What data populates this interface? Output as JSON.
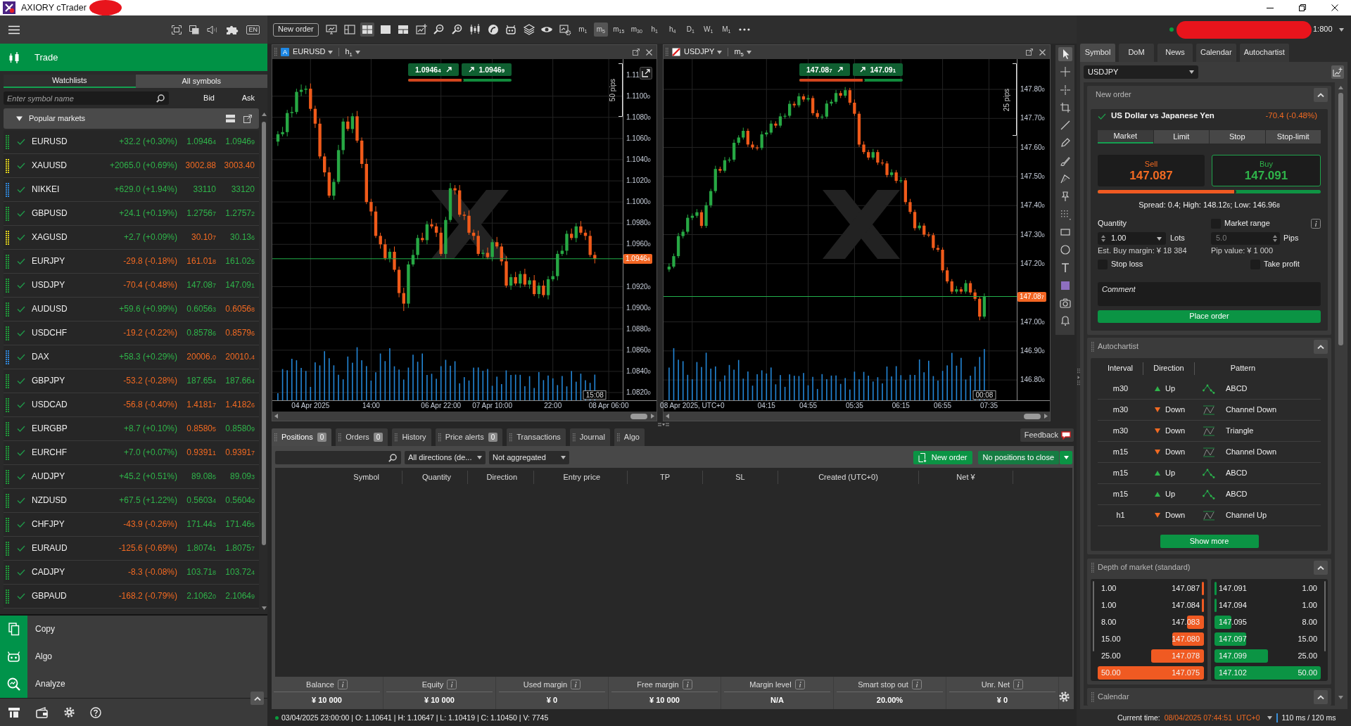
{
  "window": {
    "title": "AXIORY cTrader"
  },
  "left_panel": {
    "language": "EN",
    "section": "Trade",
    "tabs": [
      {
        "label": "Watchlists",
        "selected": true
      },
      {
        "label": "All symbols",
        "selected": false
      }
    ],
    "search": {
      "placeholder": "Enter symbol name"
    },
    "columns": [
      "Bid",
      "Ask"
    ],
    "group": {
      "title": "Popular markets",
      "expanded": true
    },
    "symbols": [
      {
        "name": "EURUSD",
        "color": "#1f9a3a",
        "change": "+32.2 (+0.30%)",
        "change_up": true,
        "bid": "1.0946$_{4}$",
        "bid_up": true,
        "ask": "1.0946$_{9}$",
        "ask_up": true
      },
      {
        "name": "XAUUSD",
        "color": "#e0d21c",
        "change": "+2065.0 (+0.69%)",
        "change_up": true,
        "bid": "3002.88",
        "bid_up": false,
        "ask": "3003.40",
        "ask_up": false
      },
      {
        "name": "NIKKEI",
        "color": "#2f86d8",
        "change": "+629.0 (+1.94%)",
        "change_up": true,
        "bid": "33110",
        "bid_up": true,
        "ask": "33120",
        "ask_up": true
      },
      {
        "name": "GBPUSD",
        "color": "#1f9a3a",
        "change": "+24.1 (+0.19%)",
        "change_up": true,
        "bid": "1.2756$_{7}$",
        "bid_up": true,
        "ask": "1.2757$_{2}$",
        "ask_up": true
      },
      {
        "name": "XAGUSD",
        "color": "#e0d21c",
        "change": "+2.7 (+0.09%)",
        "change_up": true,
        "bid": "30.10$_{7}$",
        "bid_up": false,
        "ask": "30.13$_{6}$",
        "ask_up": true
      },
      {
        "name": "EURJPY",
        "color": "#1f9a3a",
        "change": "-29.8 (-0.18%)",
        "change_up": false,
        "bid": "161.01$_{8}$",
        "bid_up": false,
        "ask": "161.02$_{5}$",
        "ask_up": true
      },
      {
        "name": "USDJPY",
        "color": "#1f9a3a",
        "change": "-70.4 (-0.48%)",
        "change_up": false,
        "bid": "147.08$_{7}$",
        "bid_up": true,
        "ask": "147.09$_{1}$",
        "ask_up": true
      },
      {
        "name": "AUDUSD",
        "color": "#1f9a3a",
        "change": "+59.6 (+0.99%)",
        "change_up": true,
        "bid": "0.6056$_{3}$",
        "bid_up": true,
        "ask": "0.6056$_{8}$",
        "ask_up": false
      },
      {
        "name": "USDCHF",
        "color": "#1f9a3a",
        "change": "-19.2 (-0.22%)",
        "change_up": false,
        "bid": "0.8578$_{6}$",
        "bid_up": true,
        "ask": "0.8579$_{6}$",
        "ask_up": false
      },
      {
        "name": "DAX",
        "color": "#2f86d8",
        "change": "+58.3 (+0.29%)",
        "change_up": true,
        "bid": "20006.$_{0}$",
        "bid_up": false,
        "ask": "20010.$_{4}$",
        "ask_up": false
      },
      {
        "name": "GBPJPY",
        "color": "#1f9a3a",
        "change": "-53.2 (-0.28%)",
        "change_up": false,
        "bid": "187.65$_{4}$",
        "bid_up": true,
        "ask": "187.66$_{4}$",
        "ask_up": true
      },
      {
        "name": "USDCAD",
        "color": "#1f9a3a",
        "change": "-56.8 (-0.40%)",
        "change_up": false,
        "bid": "1.4181$_{7}$",
        "bid_up": false,
        "ask": "1.4182$_{6}$",
        "ask_up": false
      },
      {
        "name": "EURGBP",
        "color": "#1f9a3a",
        "change": "+8.7 (+0.10%)",
        "change_up": true,
        "bid": "0.8580$_{5}$",
        "bid_up": false,
        "ask": "0.8580$_{9}$",
        "ask_up": true
      },
      {
        "name": "EURCHF",
        "color": "#1f9a3a",
        "change": "+7.0 (+0.07%)",
        "change_up": true,
        "bid": "0.9391$_{1}$",
        "bid_up": false,
        "ask": "0.9391$_{7}$",
        "ask_up": false
      },
      {
        "name": "AUDJPY",
        "color": "#1f9a3a",
        "change": "+45.2 (+0.51%)",
        "change_up": true,
        "bid": "89.08$_{5}$",
        "bid_up": true,
        "ask": "89.09$_{3}$",
        "ask_up": true
      },
      {
        "name": "NZDUSD",
        "color": "#1f9a3a",
        "change": "+67.5 (+1.22%)",
        "change_up": true,
        "bid": "0.5603$_{4}$",
        "bid_up": true,
        "ask": "0.5604$_{0}$",
        "ask_up": true
      },
      {
        "name": "CHFJPY",
        "color": "#1f9a3a",
        "change": "-43.9 (-0.26%)",
        "change_up": false,
        "bid": "171.44$_{3}$",
        "bid_up": true,
        "ask": "171.46$_{5}$",
        "ask_up": true
      },
      {
        "name": "EURAUD",
        "color": "#1f9a3a",
        "change": "-125.6 (-0.69%)",
        "change_up": false,
        "bid": "1.8074$_{1}$",
        "bid_up": true,
        "ask": "1.8075$_{7}$",
        "ask_up": true
      },
      {
        "name": "CADJPY",
        "color": "#1f9a3a",
        "change": "-8.3 (-0.08%)",
        "change_up": false,
        "bid": "103.71$_{8}$",
        "bid_up": true,
        "ask": "103.72$_{4}$",
        "ask_up": true
      },
      {
        "name": "GBPAUD",
        "color": "#1f9a3a",
        "change": "-168.2 (-0.79%)",
        "change_up": false,
        "bid": "2.1062$_{0}$",
        "bid_up": true,
        "ask": "2.1064$_{9}$",
        "ask_up": true
      }
    ],
    "nav": [
      {
        "label": "Copy"
      },
      {
        "label": "Algo"
      },
      {
        "label": "Analyze"
      }
    ]
  },
  "toolbar": {
    "new_order": "New order",
    "layouts": [
      {
        "selected": false
      },
      {
        "selected": true
      },
      {
        "selected": false
      },
      {
        "selected": false
      }
    ],
    "timeframes": [
      {
        "label": "m$_{1}$",
        "selected": false
      },
      {
        "label": "m$_{5}$",
        "selected": true
      },
      {
        "label": "m$_{15}$",
        "selected": false
      },
      {
        "label": "m$_{30}$",
        "selected": false
      },
      {
        "label": "h$_{1}$",
        "selected": false
      },
      {
        "label": "h$_{4}$",
        "selected": false
      },
      {
        "label": "D$_{1}$",
        "selected": false
      },
      {
        "label": "W$_{1}$",
        "selected": false
      },
      {
        "label": "M$_{1}$",
        "selected": false
      }
    ]
  },
  "charts": [
    {
      "symbol": "EURUSD",
      "badge": "A",
      "timeframe": "h$_{1}$",
      "sell": "1.0946$_{4}$",
      "buy": "1.0946$_{9}$",
      "bar": {
        "level": 0.54
      },
      "ruler": "50 pips",
      "popout_button": true,
      "axis_top_label": "1.11",
      "countdown": "15:08",
      "chart_data": {
        "type": "candlestick",
        "grid": true,
        "categories": [
          null,
          null,
          null,
          null,
          null,
          null,
          null,
          "04 Apr 2025",
          null,
          null,
          null,
          null,
          null,
          null,
          null,
          null,
          null,
          null,
          null,
          null,
          "14:00",
          null,
          null,
          null,
          null,
          null,
          null,
          null,
          null,
          null,
          null,
          null,
          null,
          null,
          null,
          "06 Apr 22:00",
          null,
          null,
          null,
          null,
          null,
          null,
          null,
          null,
          null,
          null,
          "07 Apr 10:00",
          null,
          null,
          null,
          null,
          null,
          null,
          null,
          null,
          null,
          null,
          null,
          null,
          "22:00",
          null,
          null,
          null,
          null,
          null,
          null,
          null,
          null,
          null,
          null,
          null,
          "08 Apr 06:00",
          null,
          null
        ],
        "ohlc": [
          [
            1.1057,
            1.1067,
            1.1053,
            1.1064
          ],
          [
            1.1064,
            1.1071,
            1.1062,
            1.1066
          ],
          [
            1.1066,
            1.1087,
            1.1062,
            1.1084
          ],
          [
            1.1084,
            1.109,
            1.108,
            1.1085
          ],
          [
            1.1085,
            1.1107,
            1.1083,
            1.1104
          ],
          [
            1.1104,
            1.1111,
            1.11,
            1.1106
          ],
          [
            1.1106,
            1.111,
            1.1102,
            1.1107
          ],
          [
            1.1107,
            1.1112,
            1.1086,
            1.1088
          ],
          [
            1.1088,
            1.1091,
            1.107,
            1.1074
          ],
          [
            1.1074,
            1.1079,
            1.1041,
            1.1043
          ],
          [
            1.1043,
            1.1046,
            1.1024,
            1.1028
          ],
          [
            1.1028,
            1.1033,
            1.1004,
            1.1006
          ],
          [
            1.1006,
            1.1022,
            1.1002,
            1.1019
          ],
          [
            1.1019,
            1.1054,
            1.1017,
            1.1049
          ],
          [
            1.1049,
            1.1079,
            1.1045,
            1.1076
          ],
          [
            1.1076,
            1.1081,
            1.1067,
            1.1069
          ],
          [
            1.1069,
            1.1084,
            1.1065,
            1.1081
          ],
          [
            1.1081,
            1.1086,
            1.1056,
            1.1058
          ],
          [
            1.1058,
            1.1061,
            1.1032,
            1.1036
          ],
          [
            1.1036,
            1.1041,
            1.0998,
            1.1
          ],
          [
            1.1,
            1.1003,
            1.0987,
            1.0991
          ],
          [
            1.0991,
            1.0996,
            1.0966,
            1.0968
          ],
          [
            1.0968,
            1.0971,
            1.0956,
            1.096
          ],
          [
            1.096,
            1.0965,
            1.0945,
            1.0947
          ],
          [
            1.0947,
            1.0956,
            1.0943,
            1.0953
          ],
          [
            1.0953,
            1.0958,
            1.0934,
            1.0936
          ],
          [
            1.0936,
            1.0939,
            1.091,
            1.0914
          ],
          [
            1.0914,
            1.0919,
            1.0897,
            1.0904
          ],
          [
            1.0904,
            1.0944,
            1.09,
            1.0941
          ],
          [
            1.0941,
            1.0955,
            1.0939,
            1.095
          ],
          [
            1.095,
            1.0969,
            1.0946,
            1.0966
          ],
          [
            1.0966,
            1.0971,
            1.0962,
            1.0964
          ],
          [
            1.0964,
            1.0982,
            1.096,
            1.0979
          ],
          [
            1.0979,
            1.0984,
            1.0975,
            1.0977
          ],
          [
            1.0977,
            1.098,
            1.0967,
            1.0971
          ],
          [
            1.0971,
            1.0976,
            1.0949,
            1.0951
          ],
          [
            1.0951,
            1.0986,
            1.0947,
            1.0983
          ],
          [
            1.0983,
            1.1018,
            1.0981,
            1.1013
          ],
          [
            1.1013,
            1.1016,
            1.1007,
            1.1011
          ],
          [
            1.1011,
            1.1016,
            1.0986,
            1.0988
          ],
          [
            1.0988,
            1.0991,
            1.0983,
            1.0987
          ],
          [
            1.0987,
            1.0992,
            1.0969,
            1.0971
          ],
          [
            1.0971,
            1.0974,
            1.0964,
            1.0968
          ],
          [
            1.0968,
            1.0973,
            1.0949,
            1.0951
          ],
          [
            1.0951,
            1.0955,
            1.0947,
            1.0952
          ],
          [
            1.0952,
            1.0957,
            1.0946,
            1.0948
          ],
          [
            1.0948,
            1.0965,
            1.0944,
            1.0962
          ],
          [
            1.0962,
            1.0967,
            1.0956,
            1.0958
          ],
          [
            1.0958,
            1.0961,
            1.094,
            1.0944
          ],
          [
            1.0944,
            1.0949,
            1.0919,
            1.0921
          ],
          [
            1.0921,
            1.0932,
            1.0917,
            1.0929
          ],
          [
            1.0929,
            1.0934,
            1.0921,
            1.0923
          ],
          [
            1.0923,
            1.0935,
            1.0919,
            1.0932
          ],
          [
            1.0932,
            1.0937,
            1.092,
            1.0922
          ],
          [
            1.0922,
            1.0929,
            1.0918,
            1.0926
          ],
          [
            1.0926,
            1.0931,
            1.0911,
            1.0913
          ],
          [
            1.0913,
            1.0924,
            1.0909,
            1.0921
          ],
          [
            1.0921,
            1.0926,
            1.091,
            1.0912
          ],
          [
            1.0912,
            1.093,
            1.0908,
            1.0927
          ],
          [
            1.0927,
            1.0935,
            1.0925,
            1.093
          ],
          [
            1.093,
            1.0954,
            1.0926,
            1.0951
          ],
          [
            1.0951,
            1.0959,
            1.0949,
            1.0954
          ],
          [
            1.0954,
            1.0973,
            1.095,
            1.097
          ],
          [
            1.097,
            1.0975,
            1.0964,
            1.0966
          ],
          [
            1.0966,
            1.098,
            1.0962,
            1.0977
          ],
          [
            1.0977,
            1.0982,
            1.0969,
            1.0971
          ],
          [
            1.0971,
            1.0974,
            1.0964,
            1.0968
          ],
          [
            1.0968,
            1.0973,
            1.0948,
            1.095
          ],
          [
            1.095,
            1.0953,
            1.0942,
            1.09464
          ],
          null,
          null,
          null,
          null,
          null
        ],
        "ylim": [
          1.08127,
          1.1135
        ],
        "yticks": [
          {
            "value": 1.11,
            "label": "1.11000"
          },
          {
            "value": 1.108,
            "label": "1.10800"
          },
          {
            "value": 1.106,
            "label": "1.10600"
          },
          {
            "value": 1.104,
            "label": "1.10400"
          },
          {
            "value": 1.102,
            "label": "1.10200"
          },
          {
            "value": 1.1,
            "label": "1.10000"
          },
          {
            "value": 1.098,
            "label": "1.09800"
          },
          {
            "value": 1.096,
            "label": "1.09600"
          },
          {
            "value": 1.092,
            "label": "1.09200"
          },
          {
            "value": 1.09,
            "label": "1.09000"
          },
          {
            "value": 1.088,
            "label": "1.08800"
          },
          {
            "value": 1.086,
            "label": "1.08600"
          },
          {
            "value": 1.084,
            "label": "1.08400"
          },
          {
            "value": 1.082,
            "label": "1.08200"
          }
        ],
        "annotations": [
          {
            "y": 1.09464,
            "text": "1.0946$_{4}$"
          }
        ]
      }
    },
    {
      "symbol": "USDJPY",
      "timeframe": "m$_{5}$",
      "sell": "147.08$_{7}$",
      "buy": "147.09$_{1}$",
      "bar": {
        "level": 0.63
      },
      "ruler": "25 pips",
      "countdown": "00:08",
      "chart_data": {
        "type": "candlestick",
        "grid": true,
        "categories": [
          null,
          null,
          null,
          null,
          null,
          "08 Apr 2025, UTC+0",
          null,
          null,
          null,
          null,
          null,
          null,
          null,
          null,
          null,
          null,
          null,
          null,
          null,
          null,
          null,
          "04:15",
          null,
          null,
          null,
          null,
          null,
          null,
          null,
          null,
          "04:55",
          null,
          null,
          null,
          null,
          null,
          null,
          null,
          null,
          null,
          "05:35",
          null,
          null,
          null,
          null,
          null,
          null,
          null,
          null,
          null,
          "06:15",
          null,
          null,
          null,
          null,
          null,
          null,
          null,
          null,
          "06:55",
          null,
          null,
          null,
          null,
          null,
          null,
          null,
          null,
          null,
          "07:35",
          null,
          null,
          null,
          null,
          null
        ],
        "ohlc": [
          [
            147.18,
            147.201,
            147.172,
            147.19
          ],
          [
            147.19,
            147.235,
            147.184,
            147.226
          ],
          [
            147.226,
            147.306,
            147.219,
            147.295
          ],
          [
            147.295,
            147.318,
            147.287,
            147.31
          ],
          [
            147.31,
            147.369,
            147.303,
            147.358
          ],
          [
            147.358,
            147.373,
            147.35,
            147.365
          ],
          [
            147.365,
            147.388,
            147.358,
            147.377
          ],
          [
            147.377,
            147.385,
            147.322,
            147.33
          ],
          [
            147.33,
            147.412,
            147.323,
            147.401
          ],
          [
            147.401,
            147.458,
            147.393,
            147.45
          ],
          [
            147.45,
            147.537,
            147.443,
            147.526
          ],
          [
            147.526,
            147.534,
            147.512,
            147.52
          ],
          [
            147.52,
            147.567,
            147.513,
            147.556
          ],
          [
            147.556,
            147.566,
            147.548,
            147.558
          ],
          [
            147.558,
            147.627,
            147.551,
            147.616
          ],
          [
            147.616,
            147.642,
            147.608,
            147.634
          ],
          [
            147.634,
            147.668,
            147.627,
            147.657
          ],
          [
            147.657,
            147.665,
            147.602,
            147.61
          ],
          [
            147.61,
            147.621,
            147.593,
            147.6
          ],
          [
            147.6,
            147.608,
            147.59,
            147.598
          ],
          [
            147.598,
            147.656,
            147.591,
            147.645
          ],
          [
            147.645,
            147.659,
            147.637,
            147.651
          ],
          [
            147.651,
            147.693,
            147.644,
            147.682
          ],
          [
            147.682,
            147.69,
            147.667,
            147.675
          ],
          [
            147.675,
            147.718,
            147.668,
            147.707
          ],
          [
            147.707,
            147.717,
            147.699,
            147.709
          ],
          [
            147.709,
            147.761,
            147.702,
            147.75
          ],
          [
            147.75,
            147.758,
            147.737,
            147.745
          ],
          [
            147.745,
            147.787,
            147.738,
            147.776
          ],
          [
            147.776,
            147.784,
            147.757,
            147.765
          ],
          [
            147.765,
            147.781,
            147.758,
            147.77
          ],
          [
            147.77,
            147.778,
            147.71,
            147.718
          ],
          [
            147.718,
            147.729,
            147.698,
            147.705
          ],
          [
            147.705,
            147.714,
            147.697,
            147.706
          ],
          [
            147.706,
            147.762,
            147.699,
            147.751
          ],
          [
            147.751,
            147.765,
            147.743,
            147.757
          ],
          [
            147.757,
            147.798,
            147.75,
            147.787
          ],
          [
            147.787,
            147.795,
            147.77,
            147.778
          ],
          [
            147.778,
            147.808,
            147.771,
            147.797
          ],
          [
            147.797,
            147.805,
            147.746,
            147.754
          ],
          [
            147.754,
            147.765,
            147.709,
            147.716
          ],
          [
            147.716,
            147.724,
            147.602,
            147.61
          ],
          [
            147.61,
            147.621,
            147.577,
            147.584
          ],
          [
            147.584,
            147.592,
            147.557,
            147.565
          ],
          [
            147.565,
            147.595,
            147.558,
            147.584
          ],
          [
            147.584,
            147.592,
            147.54,
            147.548
          ],
          [
            147.548,
            147.559,
            147.538,
            147.545
          ],
          [
            147.545,
            147.553,
            147.497,
            147.505
          ],
          [
            147.505,
            147.525,
            147.498,
            147.514
          ],
          [
            147.514,
            147.522,
            147.477,
            147.485
          ],
          [
            147.485,
            147.498,
            147.478,
            147.487
          ],
          [
            147.487,
            147.495,
            147.404,
            147.412
          ],
          [
            147.412,
            147.423,
            147.371,
            147.378
          ],
          [
            147.378,
            147.386,
            147.314,
            147.322
          ],
          [
            147.322,
            147.342,
            147.315,
            147.331
          ],
          [
            147.331,
            147.339,
            147.292,
            147.3
          ],
          [
            147.3,
            147.309,
            147.291,
            147.298
          ],
          [
            147.298,
            147.306,
            147.246,
            147.254
          ],
          [
            147.254,
            147.265,
            147.241,
            147.248
          ],
          [
            147.248,
            147.256,
            147.169,
            147.177
          ],
          [
            147.177,
            147.188,
            147.132,
            147.139
          ],
          [
            147.139,
            147.147,
            147.096,
            147.104
          ],
          [
            147.104,
            147.123,
            147.097,
            147.112
          ],
          [
            147.112,
            147.12,
            147.096,
            147.104
          ],
          [
            147.104,
            147.144,
            147.097,
            147.133
          ],
          [
            147.133,
            147.141,
            147.093,
            147.101
          ],
          [
            147.101,
            147.112,
            147.072,
            147.079
          ],
          [
            147.079,
            147.087,
            147.005,
            147.018
          ],
          [
            147.018,
            147.098,
            147.011,
            147.087
          ],
          null,
          null,
          null,
          null,
          null,
          null
        ],
        "ylim": [
          146.73,
          147.904
        ],
        "yticks": [
          {
            "value": 147.8,
            "label": "147.800"
          },
          {
            "value": 147.7,
            "label": "147.700"
          },
          {
            "value": 147.6,
            "label": "147.600"
          },
          {
            "value": 147.5,
            "label": "147.500"
          },
          {
            "value": 147.4,
            "label": "147.400"
          },
          {
            "value": 147.3,
            "label": "147.300"
          },
          {
            "value": 147.2,
            "label": "147.200"
          },
          {
            "value": 147,
            "label": "147.000"
          },
          {
            "value": 146.9,
            "label": "146.900"
          },
          {
            "value": 146.8,
            "label": "146.800"
          }
        ],
        "annotations": [
          {
            "y": 147.087,
            "text": "147.08$_{7}$"
          }
        ]
      }
    }
  ],
  "drawing_tools": [
    {
      "selected": true
    },
    {
      "selected": false
    },
    {
      "selected": false
    },
    {
      "selected": false
    },
    {
      "selected": false
    },
    {
      "selected": false
    },
    {
      "selected": false
    },
    {
      "selected": false
    },
    {
      "selected": false
    },
    {
      "selected": false
    },
    {
      "selected": false
    },
    {
      "selected": false
    },
    {
      "selected": false
    },
    {
      "selected": false
    },
    {
      "selected": false
    },
    {
      "selected": false
    }
  ],
  "bottom_panel": {
    "tabs": [
      {
        "label": "Positions",
        "count": "0",
        "selected": true
      },
      {
        "label": "Orders",
        "count": "0",
        "selected": false
      },
      {
        "label": "History",
        "selected": false
      },
      {
        "label": "Price alerts",
        "count": "0",
        "selected": false
      },
      {
        "label": "Transactions",
        "selected": false
      },
      {
        "label": "Journal",
        "selected": false
      },
      {
        "label": "Algo",
        "selected": false
      }
    ],
    "feedback": "Feedback",
    "filters": [
      "All directions (de...",
      "Not aggregated"
    ],
    "new_order": "New order",
    "close_button": "No positions to close",
    "columns": [
      "Symbol",
      "Quantity",
      "Direction",
      "Entry price",
      "TP",
      "SL",
      "Created (UTC+0)",
      "Net ¥"
    ],
    "summary": [
      {
        "label": "Balance",
        "value": "¥ 10 000"
      },
      {
        "label": "Equity",
        "value": "¥ 10 000"
      },
      {
        "label": "Used margin",
        "value": "¥ 0"
      },
      {
        "label": "Free margin",
        "value": "¥ 10 000"
      },
      {
        "label": "Margin level",
        "value": "N/A"
      },
      {
        "label": "Smart stop out",
        "value": "20.00%"
      },
      {
        "label": "Unr. Net",
        "value": "¥ 0"
      }
    ]
  },
  "status_bar": {
    "text": "03/04/2025 23:00:00 | O: 1.10641 | H: 1.10647 | L: 1.10419 | C: 1.10450 | V: 7745"
  },
  "right_panel": {
    "leverage": "1:800",
    "tabs": [
      {
        "label": "Symbol",
        "selected": true
      },
      {
        "label": "DoM",
        "selected": false
      },
      {
        "label": "News",
        "selected": false
      },
      {
        "label": "Calendar",
        "selected": false
      },
      {
        "label": "Autochartist",
        "selected": false
      }
    ],
    "symbol": "USDJPY",
    "new_order": {
      "title": "New order",
      "expanded": true,
      "instrument": "US Dollar vs Japanese Yen",
      "change": "-70.4 (-0.48%)",
      "change_up": false,
      "order_types": [
        {
          "label": "Market",
          "selected": true
        },
        {
          "label": "Limit",
          "selected": false
        },
        {
          "label": "Stop",
          "selected": false
        },
        {
          "label": "Stop-limit",
          "selected": false
        }
      ],
      "sell": {
        "label": "Sell",
        "price": "147.087"
      },
      "buy": {
        "label": "Buy",
        "price": "147.091"
      },
      "bar": {
        "level": 0.62
      },
      "spread": "Spread: 0.4; High: 148.12$_{6}$; Low: 146.96$_{8}$",
      "quantity": {
        "label": "Quantity",
        "value": "1.00",
        "unit": "Lots"
      },
      "market_range": {
        "label": "Market range",
        "checked": false
      },
      "pips": {
        "value": "5.0",
        "unit": "Pips",
        "disabled": true
      },
      "margin": "Est. Buy margin: ¥ 18 384",
      "pip_value": "Pip value: ¥ 1 000",
      "stop_loss": {
        "label": "Stop loss",
        "checked": false
      },
      "take_profit": {
        "label": "Take profit",
        "checked": false
      },
      "comment": {
        "placeholder": "Comment"
      },
      "submit": "Place order"
    },
    "autochartist": {
      "title": "Autochartist",
      "expanded": true,
      "columns": [
        "Interval",
        "Direction",
        "Pattern"
      ],
      "rows": [
        {
          "interval": "m30",
          "direction": "Up",
          "up": true,
          "kind": "abcd",
          "pattern": "ABCD"
        },
        {
          "interval": "m30",
          "direction": "Down",
          "up": false,
          "kind": "channel",
          "pattern": "Channel Down"
        },
        {
          "interval": "m30",
          "direction": "Down",
          "up": false,
          "kind": "channel",
          "pattern": "Triangle"
        },
        {
          "interval": "m15",
          "direction": "Down",
          "up": false,
          "kind": "channel",
          "pattern": "Channel Down"
        },
        {
          "interval": "m15",
          "direction": "Up",
          "up": true,
          "kind": "abcd",
          "pattern": "ABCD"
        },
        {
          "interval": "m15",
          "direction": "Up",
          "up": true,
          "kind": "abcd",
          "pattern": "ABCD"
        },
        {
          "interval": "h1",
          "direction": "Down",
          "up": false,
          "kind": "channel",
          "pattern": "Channel Up"
        }
      ],
      "show_more": "Show more"
    },
    "dom": {
      "title": "Depth of market (standard)",
      "expanded": true,
      "bids": [
        {
          "volume": "1.00",
          "price": "147.087",
          "level": 0.02
        },
        {
          "volume": "1.00",
          "price": "147.084",
          "level": 0.02
        },
        {
          "volume": "8.00",
          "price": "147.083",
          "level": 0.16
        },
        {
          "volume": "15.00",
          "price": "147.080",
          "level": 0.3
        },
        {
          "volume": "25.00",
          "price": "147.078",
          "level": 0.5
        },
        {
          "volume": "50.00",
          "price": "147.075",
          "level": 1
        }
      ],
      "asks": [
        {
          "price": "147.091",
          "volume": "1.00",
          "level": 0.02
        },
        {
          "price": "147.094",
          "volume": "1.00",
          "level": 0.02
        },
        {
          "price": "147.095",
          "volume": "8.00",
          "level": 0.16
        },
        {
          "price": "147.097",
          "volume": "15.00",
          "level": 0.3
        },
        {
          "price": "147.099",
          "volume": "25.00",
          "level": 0.5
        },
        {
          "price": "147.102",
          "volume": "50.00",
          "level": 1
        }
      ]
    },
    "calendar": {
      "title": "Calendar",
      "expanded": true
    },
    "status": {
      "label": "Current time:",
      "time": "08/04/2025 07:44:51",
      "timezone": "UTC+0",
      "latency": "110 ms / 120 ms"
    }
  }
}
